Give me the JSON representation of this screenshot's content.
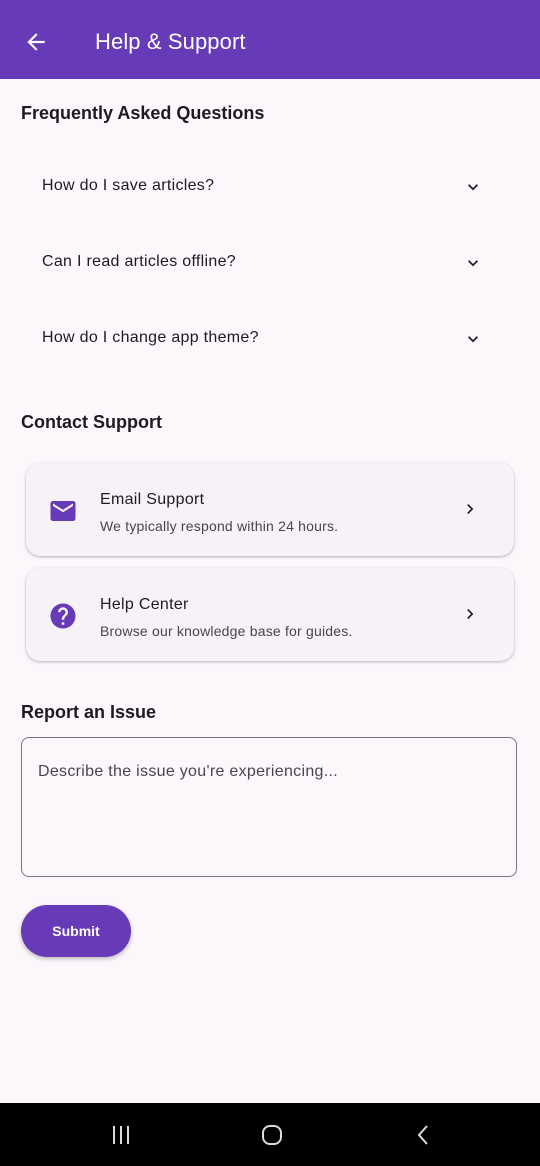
{
  "colors": {
    "primary": "#673ab7",
    "background": "#fdf7fc",
    "card": "#f7f1f8",
    "on_primary": "#ffffff",
    "text": "#1d1b20",
    "text_secondary": "#49454f"
  },
  "appbar": {
    "back_icon": "arrow-back-icon",
    "title": "Help & Support"
  },
  "faq": {
    "title": "Frequently Asked Questions",
    "items": [
      {
        "question": "How do I save articles?",
        "icon": "chevron-down-icon"
      },
      {
        "question": "Can I read articles offline?",
        "icon": "chevron-down-icon"
      },
      {
        "question": "How do I change app theme?",
        "icon": "chevron-down-icon"
      }
    ]
  },
  "contact": {
    "title": "Contact Support",
    "items": [
      {
        "icon": "email-icon",
        "title": "Email Support",
        "subtitle": "We typically respond within 24 hours."
      },
      {
        "icon": "help-icon",
        "title": "Help Center",
        "subtitle": "Browse our knowledge base for guides."
      }
    ]
  },
  "report": {
    "title": "Report an Issue",
    "placeholder": "Describe the issue you're experiencing...",
    "submit_label": "Submit"
  },
  "system_nav": {
    "buttons": [
      "recents-icon",
      "home-icon",
      "back-icon"
    ]
  }
}
